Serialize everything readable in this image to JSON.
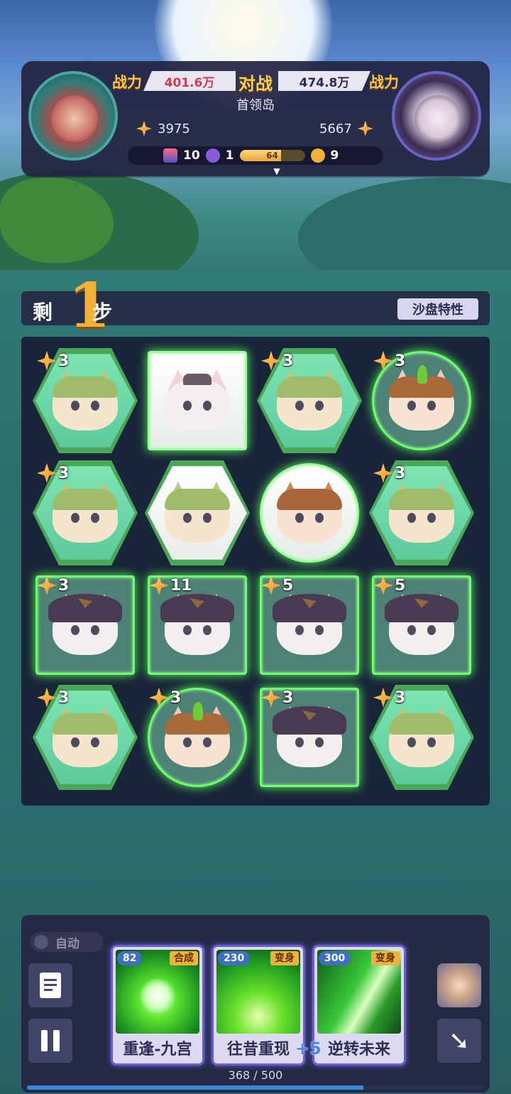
{
  "top": {
    "power_label": "战力",
    "vs_label": "对战",
    "player_power": "401.6万",
    "enemy_power": "474.8万",
    "stage_name": "首领岛",
    "player_score": "3975",
    "enemy_score": "5667",
    "stats": {
      "card_count": "10",
      "skull_count": "1",
      "energy_value": "64",
      "energy_fraction": 0.64,
      "coin_count": "9"
    }
  },
  "steps": {
    "prefix": "剩",
    "count": "1",
    "suffix": "步",
    "trait_button": "沙盘特性"
  },
  "board": {
    "rows": [
      [
        {
          "badge": "3",
          "frame": "hex",
          "type": "green-cat"
        },
        {
          "badge": "",
          "frame": "square-white",
          "type": "captain-cat"
        },
        {
          "badge": "3",
          "frame": "hex",
          "type": "green-cat"
        },
        {
          "badge": "3",
          "frame": "circle",
          "type": "horn-cat"
        }
      ],
      [
        {
          "badge": "3",
          "frame": "hex",
          "type": "green-cat"
        },
        {
          "badge": "",
          "frame": "hex-white",
          "type": "green-cat"
        },
        {
          "badge": "",
          "frame": "circle-white",
          "type": "brown-cat"
        },
        {
          "badge": "3",
          "frame": "hex",
          "type": "green-cat"
        }
      ],
      [
        {
          "badge": "3",
          "frame": "square",
          "type": "hat-cat"
        },
        {
          "badge": "11",
          "frame": "square",
          "type": "hat-cat"
        },
        {
          "badge": "5",
          "frame": "square",
          "type": "hat-cat"
        },
        {
          "badge": "5",
          "frame": "square",
          "type": "hat-cat"
        }
      ],
      [
        {
          "badge": "3",
          "frame": "hex",
          "type": "green-cat"
        },
        {
          "badge": "3",
          "frame": "circle",
          "type": "horn-cat"
        },
        {
          "badge": "3",
          "frame": "square",
          "type": "hat-cat"
        },
        {
          "badge": "3",
          "frame": "hex",
          "type": "green-cat"
        }
      ]
    ]
  },
  "bottom": {
    "auto_label": "自动",
    "cards": [
      {
        "cost": "82",
        "tag": "合成",
        "name": "重逢-九宫"
      },
      {
        "cost": "230",
        "tag": "变身",
        "name": "往昔重现"
      },
      {
        "cost": "300",
        "tag": "变身",
        "name": "逆转未来"
      }
    ],
    "bonus": "+5",
    "progress_label": "368 / 500",
    "progress_fraction": 0.736
  }
}
